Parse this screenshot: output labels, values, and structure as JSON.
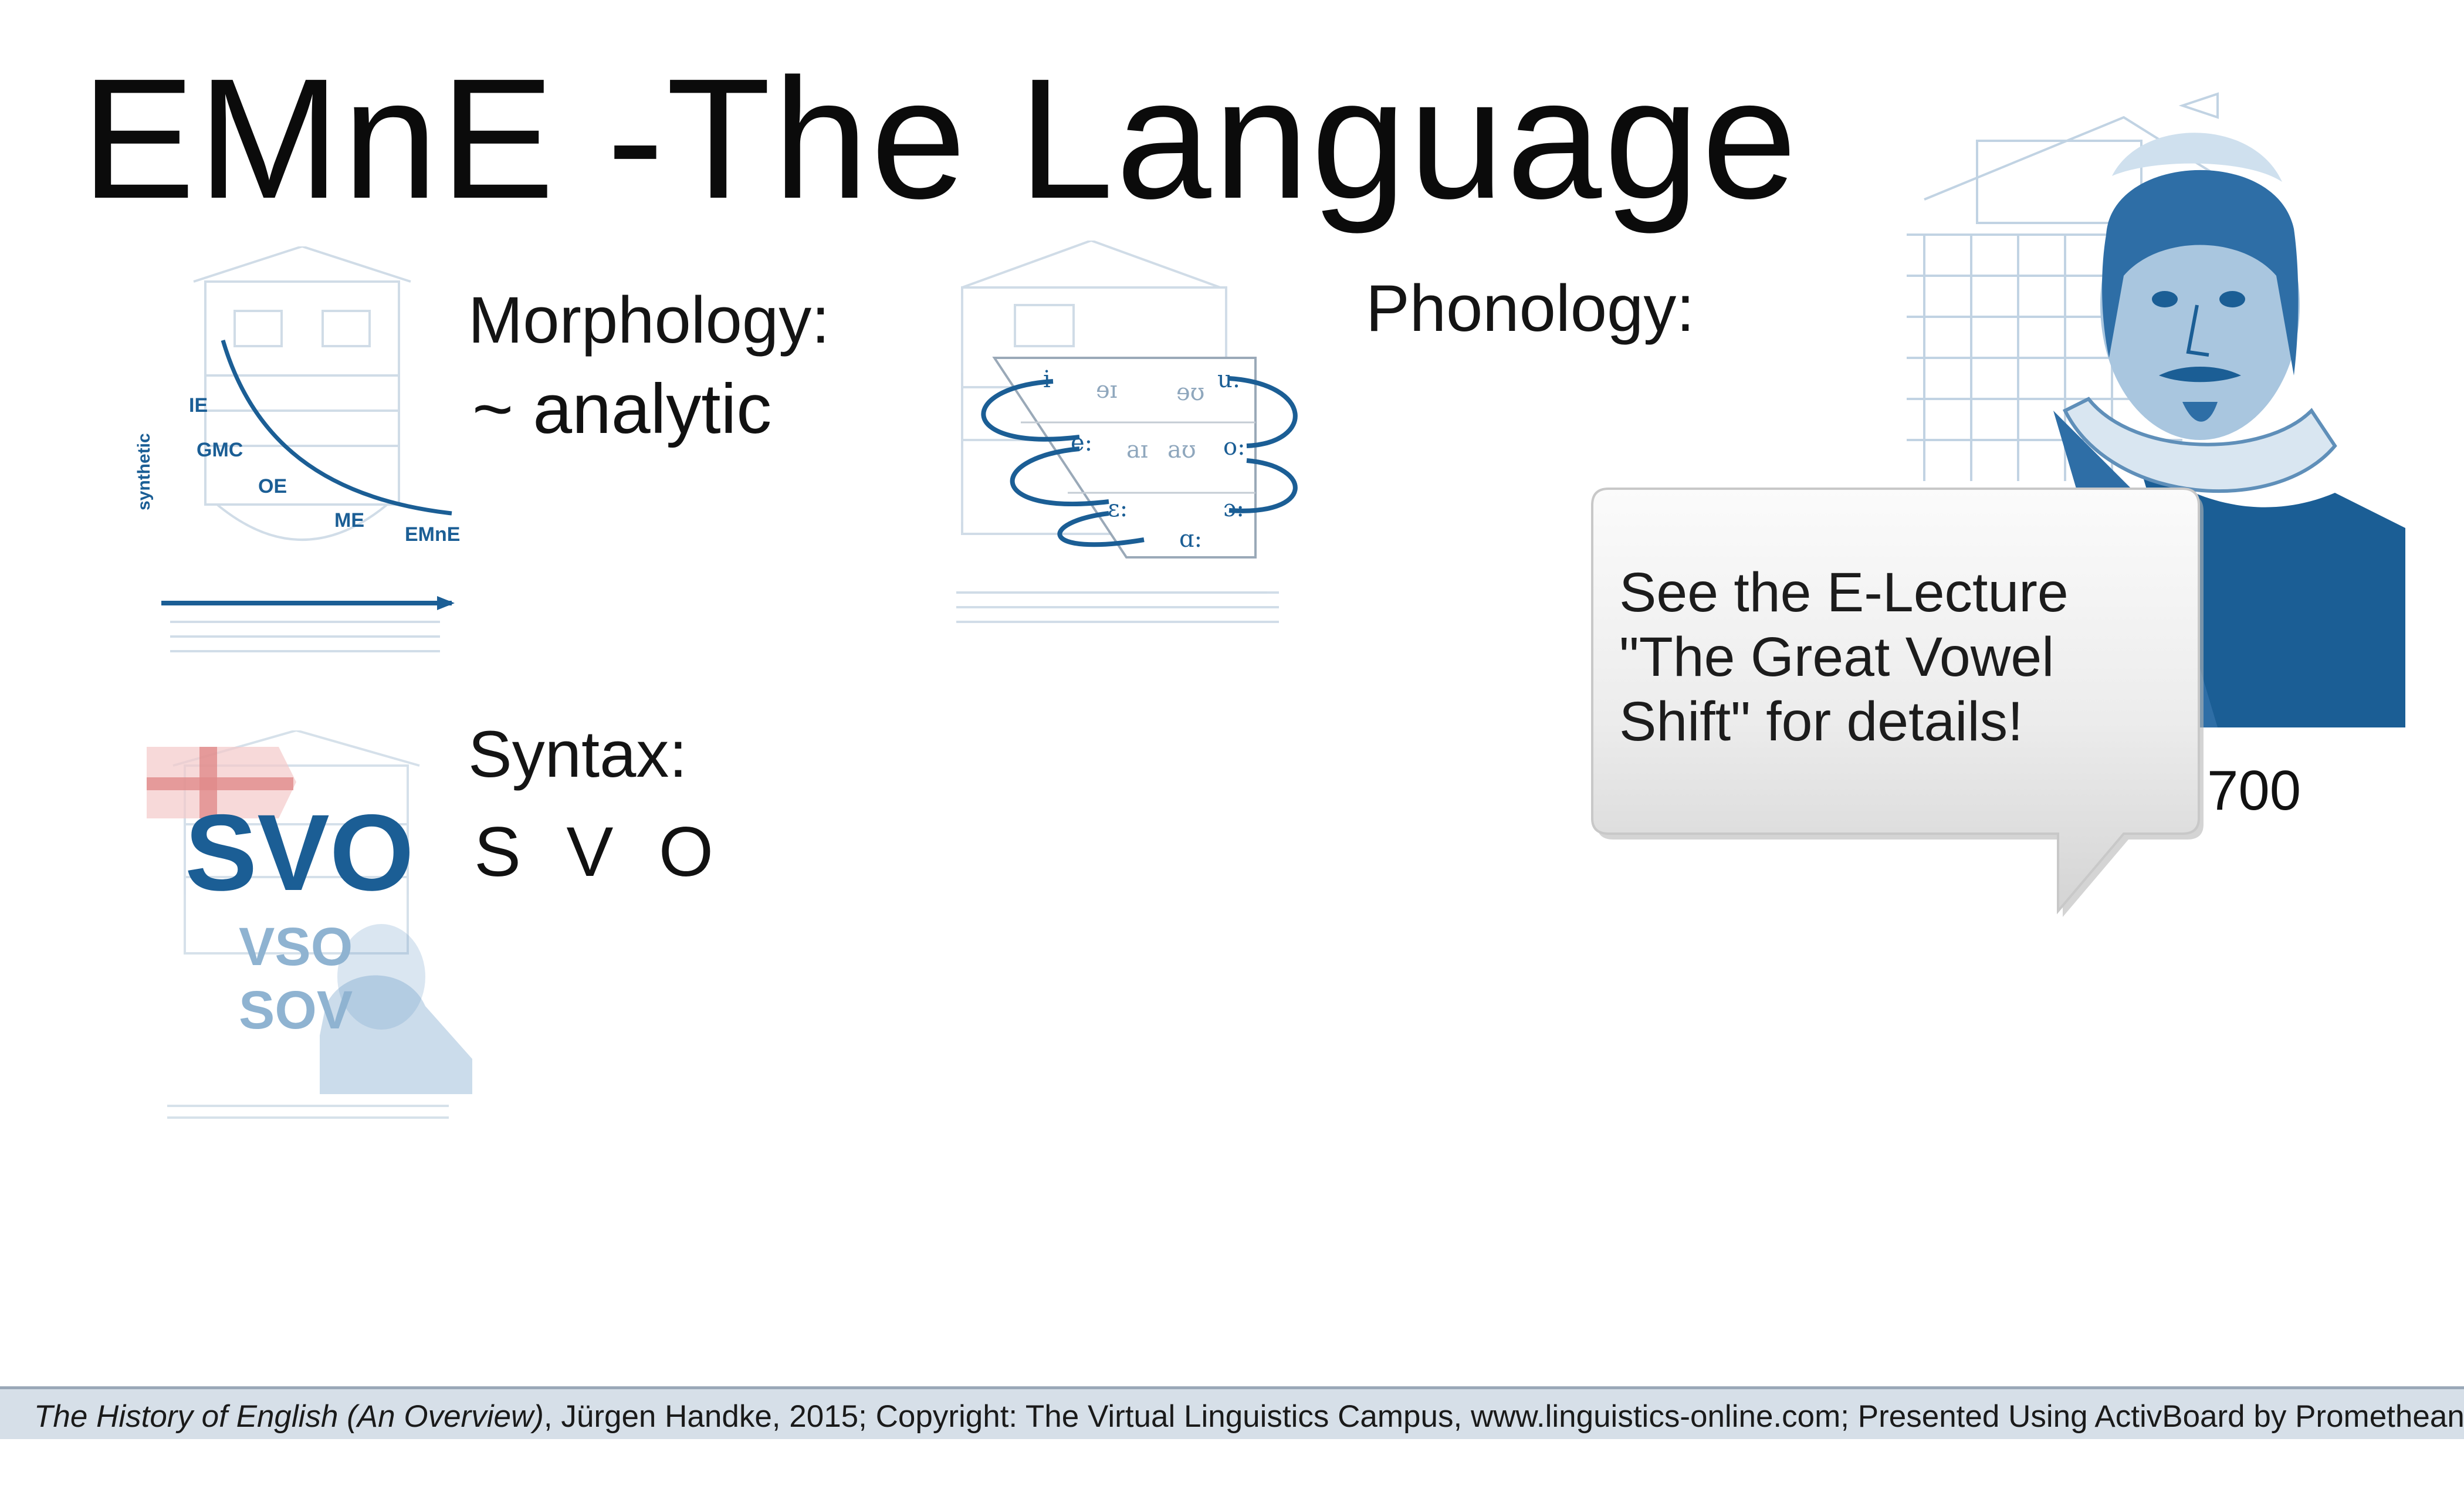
{
  "slide": {
    "title": "EMnE -The Language",
    "morphology": {
      "label": "Morphology:",
      "value": "~ analytic",
      "thumbnail": {
        "axis_label": "synthetic",
        "stages": [
          "IE",
          "GMC",
          "OE",
          "ME",
          "EMnE"
        ]
      }
    },
    "syntax": {
      "label": "Syntax:",
      "value": "S V O",
      "thumbnail": {
        "primary": "SVO",
        "secondary": [
          "VSO",
          "SOV"
        ]
      }
    },
    "phonology": {
      "label": "Phonology:",
      "thumbnail": {
        "vowels": [
          "i",
          "ɘɪ",
          "ɘʊ",
          "u:",
          "e:",
          "aɪ",
          "aʊ",
          "o:",
          "ɛ:",
          "ɔ:",
          "ɑ:"
        ]
      }
    },
    "callout": {
      "text": "See the E-Lecture \"The Great Vowel Shift\" for details!"
    },
    "partial_year": "700",
    "footer": {
      "italic_part": "The History of English (An Overview)",
      "rest": ", Jürgen Handke, 2015; Copyright: The Virtual Linguistics Campus, www.linguistics-online.com; Presented Using ActivBoard by Promethean"
    },
    "colors": {
      "accent_blue": "#1b5e95",
      "footer_bg": "#d6dfe8",
      "callout_bg": "#e6e6e6"
    }
  }
}
